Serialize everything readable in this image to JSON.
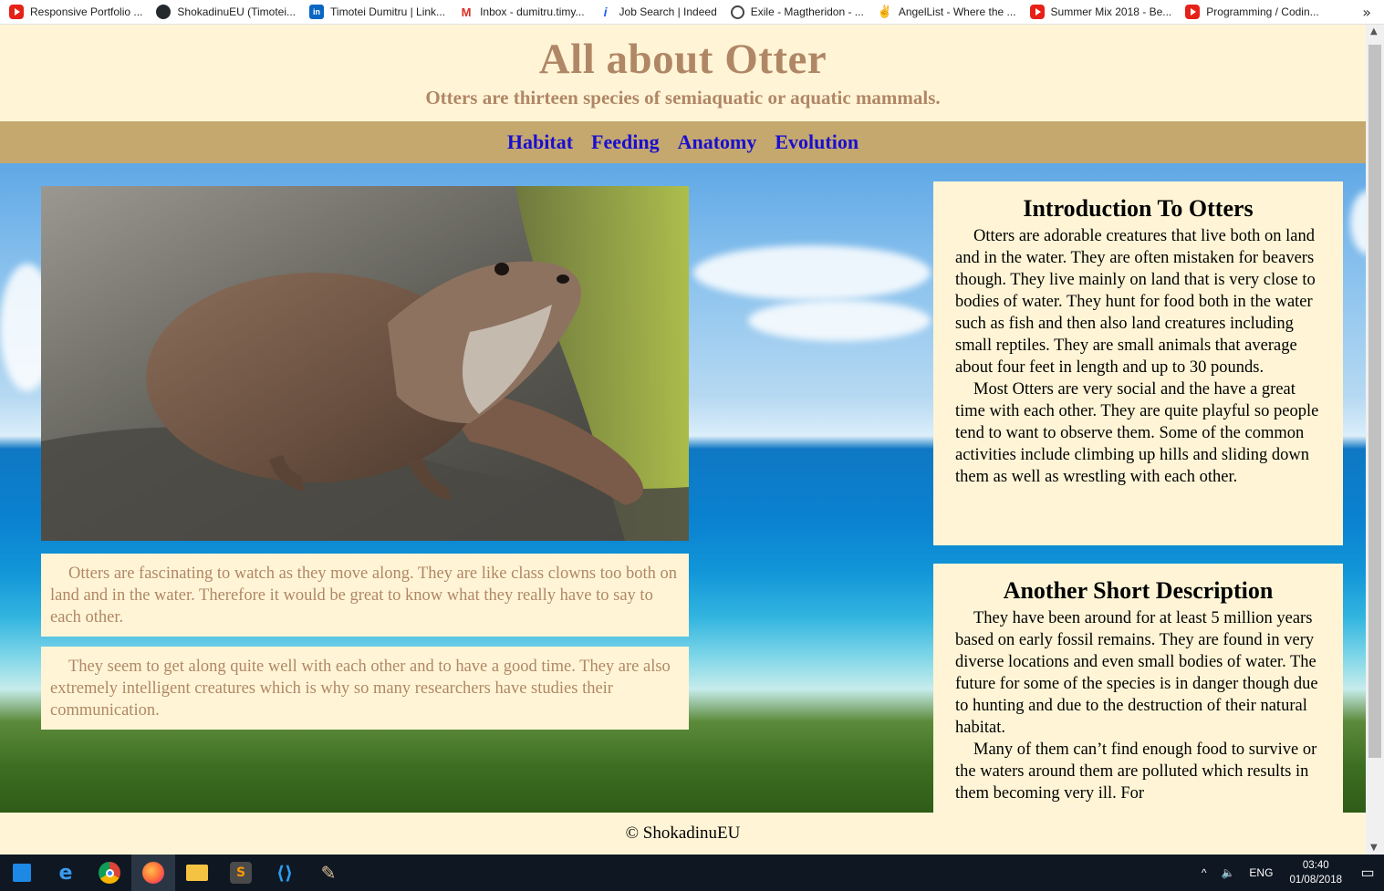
{
  "bookmarks": [
    {
      "label": "Responsive Portfolio ...",
      "icon": "youtube-icon"
    },
    {
      "label": "ShokadinuEU (Timotei...",
      "icon": "github-icon"
    },
    {
      "label": "Timotei Dumitru | Link...",
      "icon": "linkedin-icon"
    },
    {
      "label": "Inbox - dumitru.timy...",
      "icon": "gmail-icon"
    },
    {
      "label": "Job Search | Indeed",
      "icon": "indeed-icon"
    },
    {
      "label": "Exile - Magtheridon - ...",
      "icon": "globe-icon"
    },
    {
      "label": "AngelList - Where the ...",
      "icon": "angellist-icon"
    },
    {
      "label": "Summer Mix 2018 - Be...",
      "icon": "youtube-icon"
    },
    {
      "label": "Programming / Codin...",
      "icon": "youtube-icon"
    }
  ],
  "bookmarks_more": "»",
  "header": {
    "title": "All about Otter",
    "subtitle": "Otters are thirteen species of semiaquatic or aquatic mammals."
  },
  "nav": [
    "Habitat",
    "Feeding",
    "Anatomy",
    "Evolution"
  ],
  "left_boxes": [
    "Otters are fascinating to watch as they move along. They are like class clowns too both on land and in the water. Therefore it would be great to know what they really have to say to each other.",
    "They seem to get along quite well with each other and to have a good time. They are also extremely intelligent creatures which is why so many researchers have studies their communication."
  ],
  "intro": {
    "title": "Introduction To Otters",
    "paragraphs": [
      "Otters are adorable creatures that live both on land and in the water. They are often mistaken for beavers though. They live mainly on land that is very close to bodies of water. They hunt for food both in the water such as fish and then also land creatures including small reptiles. They are small animals that average about four feet in length and up to 30 pounds.",
      "Most Otters are very social and the have a great time with each other. They are quite playful so people tend to want to observe them. Some of the common activities include climbing up hills and sliding down them as well as wrestling with each other."
    ]
  },
  "description": {
    "title": "Another Short Description",
    "paragraphs": [
      "They have been around for at least 5 million years based on early fossil remains. They are found in very diverse locations and even small bodies of water. The future for some of the species is in danger though due to hunting and due to the destruction of their natural habitat.",
      "Many of them can’t find enough food to survive or the waters around them are polluted which results in them becoming very ill. For"
    ]
  },
  "footer": "© ShokadinuEU",
  "taskbar": {
    "apps": [
      "start-icon",
      "edge-icon",
      "chrome-icon",
      "firefox-icon",
      "file-explorer-icon",
      "sublime-icon",
      "vscode-icon",
      "paint-icon"
    ],
    "language": "ENG",
    "time": "03:40",
    "date": "01/08/2018"
  },
  "colors": {
    "cream": "#fff5d6",
    "tan": "#c4a86d",
    "brown_text": "#b08766",
    "nav_link": "#1a0ecf"
  }
}
